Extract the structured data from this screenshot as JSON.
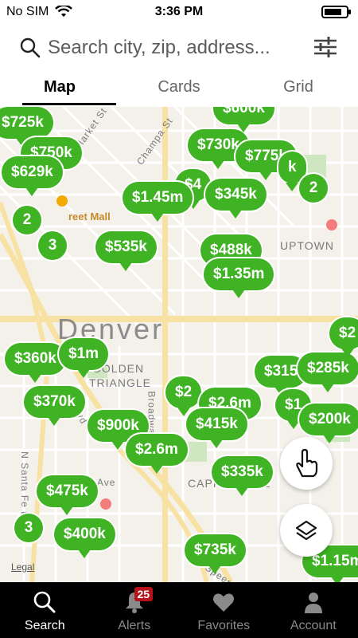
{
  "status": {
    "carrier": "No SIM",
    "time": "3:36 PM",
    "battery_fraction": 0.8
  },
  "search": {
    "placeholder": "Search city, zip, address..."
  },
  "tabs": [
    {
      "label": "Map",
      "active": true
    },
    {
      "label": "Cards",
      "active": false
    },
    {
      "label": "Grid",
      "active": false
    }
  ],
  "map": {
    "city_label": "Denver",
    "area_labels": [
      "GOLDEN",
      "TRIANGLE",
      "UPTOWN",
      "CAPITOL HILL"
    ],
    "street_labels": [
      "Champa St",
      "Market St",
      "Broadway",
      "Blvd",
      "N Santa Fe Dr",
      "Speer",
      "Ave"
    ],
    "poi_label": "reet Mall",
    "legal": "Legal",
    "prices": [
      "$725k",
      "$750k",
      "$629k",
      "$730k",
      "$775k",
      "$4",
      "$345k",
      "$1.45m",
      "$535k",
      "$488k",
      "$1.35m",
      "$360k",
      "$1m",
      "$370k",
      "$900k",
      "$2.6m",
      "$2",
      "$2.6m",
      "$415k",
      "$315",
      "$285k",
      "$1",
      "$200k",
      "$335k",
      "$475k",
      "$400k",
      "$735k",
      "$1.15m",
      "$2",
      "$600k",
      "k"
    ],
    "clusters": [
      "2",
      "2",
      "3",
      "3"
    ]
  },
  "nav": {
    "items": [
      {
        "label": "Search",
        "icon": "search-icon",
        "active": true
      },
      {
        "label": "Alerts",
        "icon": "bell-icon",
        "active": false,
        "badge": "25"
      },
      {
        "label": "Favorites",
        "icon": "heart-icon",
        "active": false
      },
      {
        "label": "Account",
        "icon": "person-icon",
        "active": false
      }
    ]
  },
  "colors": {
    "pin": "#3fb323",
    "badge": "#b5121b",
    "nav_bg": "#000000"
  }
}
